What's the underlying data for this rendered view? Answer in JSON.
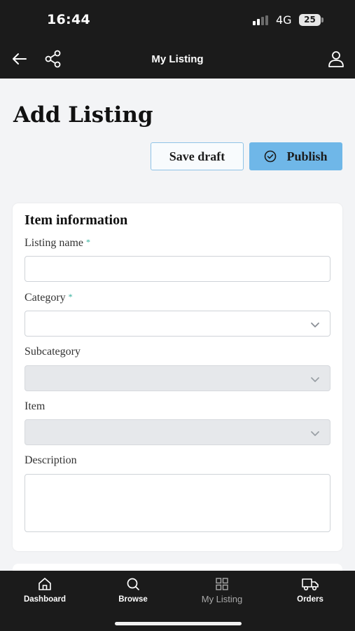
{
  "status_bar": {
    "time": "16:44",
    "network": "4G",
    "battery": "25"
  },
  "app_bar": {
    "title": "My Listing",
    "back_icon": "arrow-left-icon",
    "share_icon": "share-icon",
    "profile_icon": "user-icon"
  },
  "page": {
    "title": "Add Listing"
  },
  "actions": {
    "save_draft_label": "Save draft",
    "publish_label": "Publish",
    "publish_icon": "check-circle-icon"
  },
  "item_info": {
    "title": "Item information",
    "required_marker": "*",
    "fields": {
      "listing_name": {
        "label": "Listing name",
        "value": "",
        "required": true
      },
      "category": {
        "label": "Category",
        "value": "",
        "required": true
      },
      "subcategory": {
        "label": "Subcategory",
        "value": "",
        "disabled": true
      },
      "item": {
        "label": "Item",
        "value": "",
        "disabled": true
      },
      "description": {
        "label": "Description",
        "value": ""
      }
    }
  },
  "bottom_nav": {
    "items": [
      {
        "label": "Dashboard",
        "icon": "home-icon"
      },
      {
        "label": "Browse",
        "icon": "search-icon"
      },
      {
        "label": "My Listing",
        "icon": "grid-icon",
        "active": true
      },
      {
        "label": "Orders",
        "icon": "truck-icon"
      }
    ]
  },
  "colors": {
    "bar_bg": "#1b1b1b",
    "accent": "#6fb7e8",
    "required": "#2fae9a",
    "page_bg": "#f3f4f6"
  }
}
